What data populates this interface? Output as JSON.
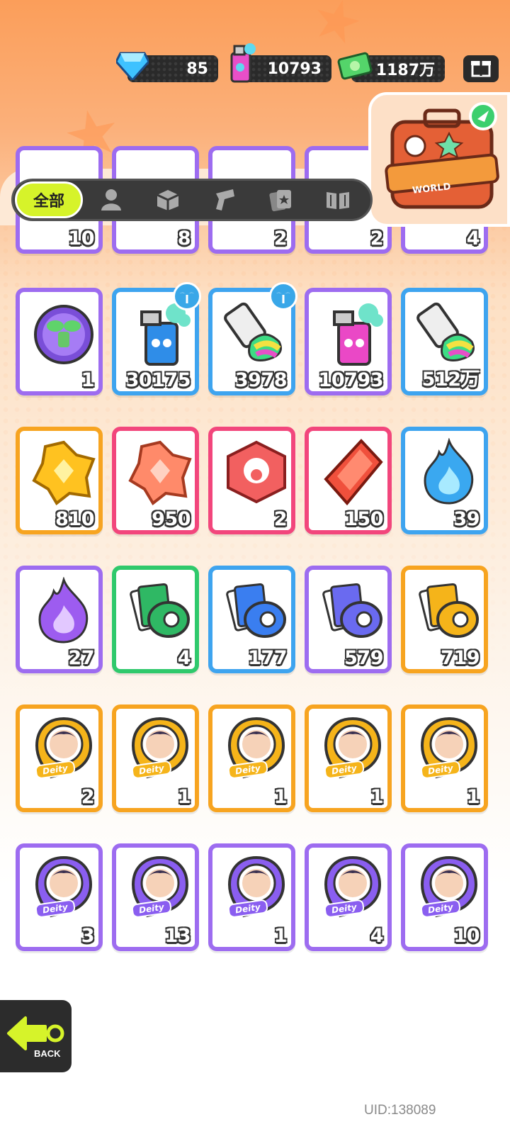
{
  "currency": {
    "gems": "85",
    "spray": "10793",
    "cash": "1187万"
  },
  "world_badge": "WORLD",
  "tabs": {
    "all_label": "全部",
    "icons": [
      "person-icon",
      "box-icon",
      "spray-gun-icon",
      "cards-icon",
      "book-icon"
    ]
  },
  "rows": [
    {
      "items": [
        {
          "count": "10",
          "color": "purple"
        },
        {
          "count": "8",
          "color": "purple"
        },
        {
          "count": "2",
          "color": "purple"
        },
        {
          "count": "2",
          "color": "purple"
        },
        {
          "count": "4",
          "color": "purple"
        }
      ]
    },
    {
      "items": [
        {
          "count": "1",
          "color": "purple",
          "icon": "plant-badge-icon"
        },
        {
          "count": "30175",
          "color": "blue",
          "icon": "blue-spray-can-icon",
          "palm_badge": true
        },
        {
          "count": "3978",
          "color": "blue",
          "icon": "paint-tube-icon",
          "palm_badge": true
        },
        {
          "count": "10793",
          "color": "purple",
          "icon": "pink-spray-can-icon"
        },
        {
          "count": "512万",
          "color": "blue",
          "icon": "paint-tube-rainbow-icon"
        }
      ]
    },
    {
      "items": [
        {
          "count": "810",
          "color": "orange",
          "icon": "gold-crystal-icon"
        },
        {
          "count": "950",
          "color": "pink",
          "icon": "orange-crystal-icon"
        },
        {
          "count": "2",
          "color": "pink",
          "icon": "red-dice-icon"
        },
        {
          "count": "150",
          "color": "pink",
          "icon": "red-gem-icon"
        },
        {
          "count": "39",
          "color": "blue",
          "icon": "blue-flame-icon"
        }
      ]
    },
    {
      "items": [
        {
          "count": "27",
          "color": "purple",
          "icon": "purple-flame-icon"
        },
        {
          "count": "4",
          "color": "green",
          "icon": "green-tape-icon"
        },
        {
          "count": "177",
          "color": "blue",
          "icon": "blue-tape-icon"
        },
        {
          "count": "579",
          "color": "purple",
          "icon": "purple-tape-icon"
        },
        {
          "count": "719",
          "color": "orange",
          "icon": "gold-tape-icon"
        }
      ]
    },
    {
      "items": [
        {
          "count": "2",
          "color": "orange",
          "icon": "deity-portrait-icon",
          "label": "Deity"
        },
        {
          "count": "1",
          "color": "orange",
          "icon": "deity-portrait-icon",
          "label": "Deity"
        },
        {
          "count": "1",
          "color": "orange",
          "icon": "deity-portrait-icon",
          "label": "Deity"
        },
        {
          "count": "1",
          "color": "orange",
          "icon": "deity-portrait-icon",
          "label": "Deity"
        },
        {
          "count": "1",
          "color": "orange",
          "icon": "deity-portrait-icon",
          "label": "Deity"
        }
      ]
    },
    {
      "items": [
        {
          "count": "3",
          "color": "purple",
          "icon": "deity-portrait-icon",
          "label": "Deity"
        },
        {
          "count": "13",
          "color": "purple",
          "icon": "deity-portrait-icon",
          "label": "Deity"
        },
        {
          "count": "1",
          "color": "purple",
          "icon": "deity-portrait-icon",
          "label": "Deity"
        },
        {
          "count": "4",
          "color": "purple",
          "icon": "deity-portrait-icon",
          "label": "Deity"
        },
        {
          "count": "10",
          "color": "purple",
          "icon": "deity-portrait-icon",
          "label": "Deity"
        }
      ]
    }
  ],
  "back_label": "BACK",
  "uid": "UID:138089",
  "colors": {
    "purple": "#9d6cf0",
    "blue": "#3ea4ef",
    "orange": "#f7a420",
    "pink": "#f2467c",
    "green": "#2fc96c",
    "tab_active": "#d6f32a"
  }
}
